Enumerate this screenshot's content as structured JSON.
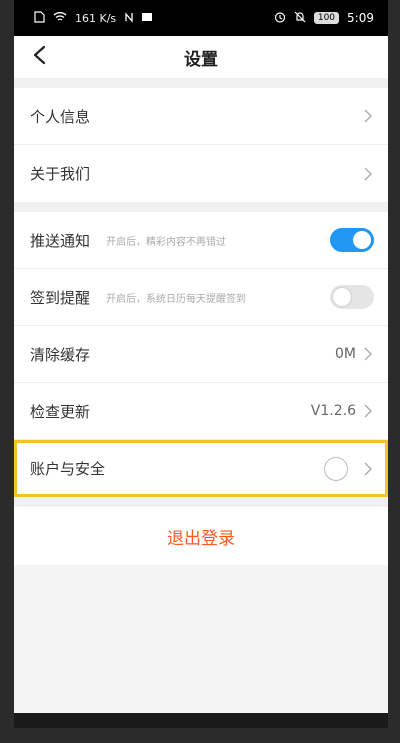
{
  "status_bar": {
    "left_signal": "161 K/s",
    "time": "5:09",
    "battery": "100"
  },
  "header": {
    "title": "设置"
  },
  "section1": [
    {
      "label": "个人信息"
    },
    {
      "label": "关于我们"
    }
  ],
  "section2": {
    "push": {
      "label": "推送通知",
      "hint": "开启后，精彩内容不再错过",
      "enabled": true
    },
    "signin": {
      "label": "签到提醒",
      "hint": "开启后，系统日历每天提醒签到",
      "enabled": false
    },
    "cache": {
      "label": "清除缓存",
      "value": "0M"
    },
    "update": {
      "label": "检查更新",
      "value": "V1.2.6"
    },
    "account": {
      "label": "账户与安全"
    }
  },
  "logout": {
    "label": "退出登录"
  },
  "colors": {
    "accent": "#2196f3",
    "highlight": "#f6c12c",
    "logout": "#ff5a1f"
  },
  "icons": [
    "back-arrow-icon",
    "chevron-right-icon"
  ]
}
